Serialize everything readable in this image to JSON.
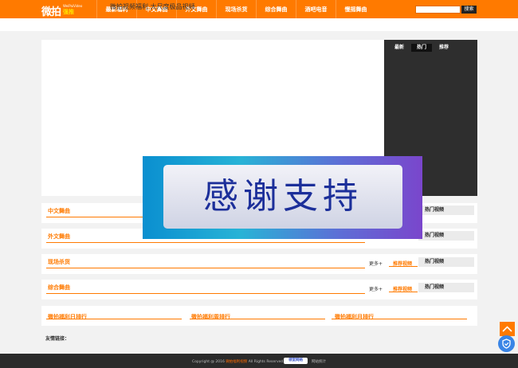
{
  "logo": {
    "main": "微拍",
    "sub": "WeiPaiVideo",
    "accent": "强推"
  },
  "nav": [
    "最新福利",
    "中文舞曲",
    "外文舞曲",
    "现场杀货",
    "综合舞曲",
    "酒吧电音",
    "慢摇舞曲"
  ],
  "search": {
    "placeholder": "",
    "button": "搜索"
  },
  "subtitle": "微拍视频福利 大尺度极品视频",
  "side_tabs": [
    "最新",
    "热门",
    "推荐"
  ],
  "banner_text": "感谢支持",
  "sections": [
    {
      "title": "中文舞曲",
      "more": "",
      "recommend": "",
      "hot": "热门视频"
    },
    {
      "title": "外文舞曲",
      "more": "",
      "recommend": "",
      "hot": "热门视频"
    },
    {
      "title": "现场杀货",
      "more": "更多+",
      "recommend": "推荐视频",
      "hot": "热门视频"
    },
    {
      "title": "综合舞曲",
      "more": "更多+",
      "recommend": "推荐视频",
      "hot": "热门视频"
    }
  ],
  "rankings": [
    "微拍福利日排行",
    "微拍福利周排行",
    "微拍福利月排行"
  ],
  "friend_links": "友情链接：",
  "footer": {
    "copyright_prefix": "Copyright @ 2016",
    "site_link": "微拍福利视频",
    "rights": "All Rights Reserved",
    "badge": "领堂网络",
    "stat": "网站统计"
  },
  "colors": {
    "brand": "#ff7a00",
    "footer": "#2b2b2b",
    "panel": "#2e2e2e",
    "accent_blue": "#3a85e6"
  },
  "icons": {
    "to_top": "chevron-up-icon",
    "shield": "shield-icon"
  }
}
